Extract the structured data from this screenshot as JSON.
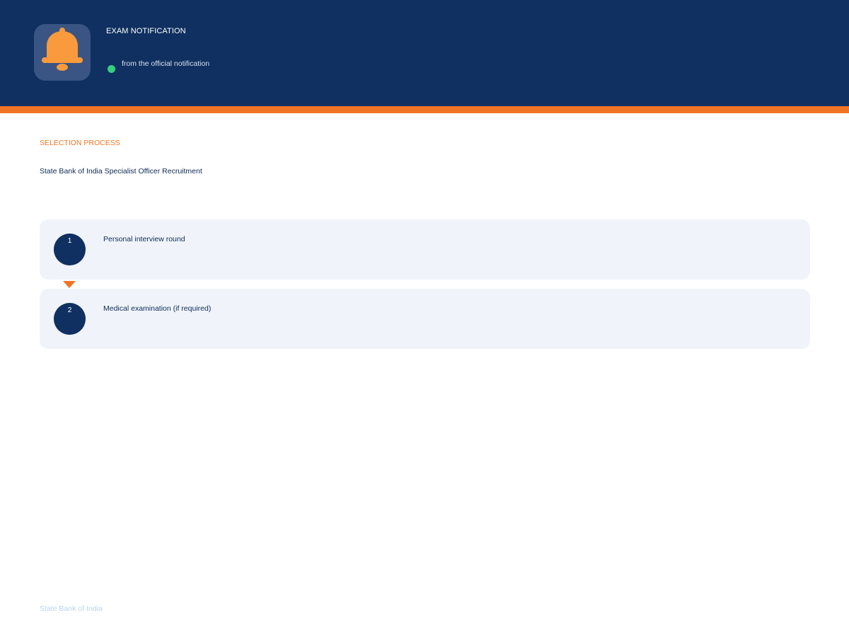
{
  "colors": {
    "header_bg": "#0f3060",
    "accent": "#f07426",
    "status_dot": "#35d07f",
    "bell": "#f99a3c",
    "card_bg": "#f0f4fa",
    "footer_text": "#b8d4ee"
  },
  "header": {
    "icon": "bell-icon",
    "title": "EXAM NOTIFICATION",
    "subtitle": "from the official notification"
  },
  "section": {
    "label": "SELECTION PROCESS",
    "title": "State Bank of India Specialist Officer Recruitment"
  },
  "steps": [
    {
      "number": "1",
      "text": "Personal interview round"
    },
    {
      "number": "2",
      "text": "Medical examination (if required)"
    }
  ],
  "footer": {
    "text": "State Bank of India"
  }
}
